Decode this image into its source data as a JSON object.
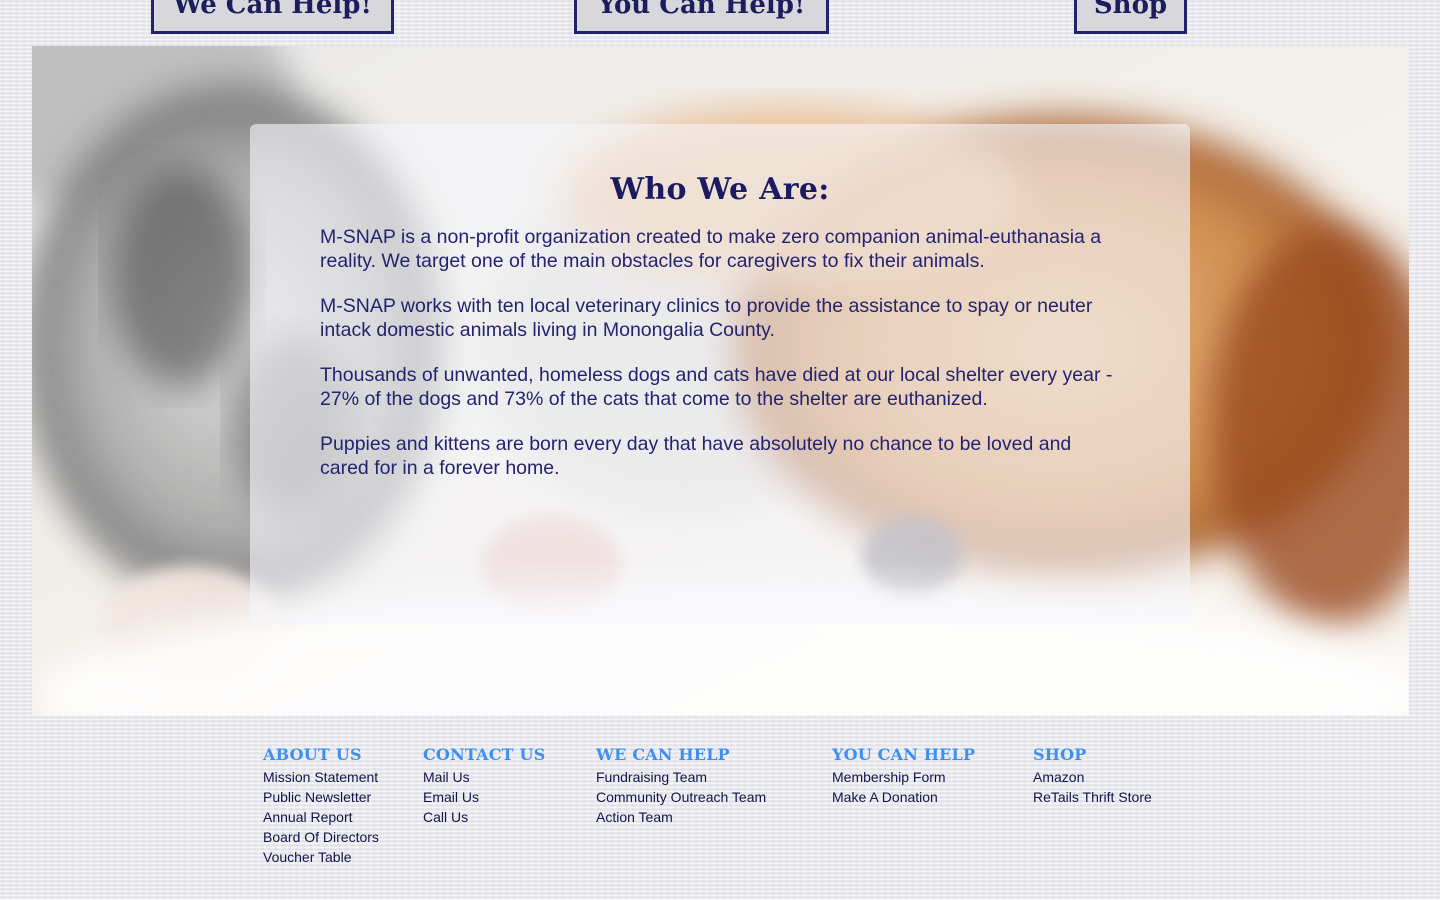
{
  "nav": {
    "tabs": [
      {
        "label": "We Can Help!"
      },
      {
        "label": "You Can Help!"
      },
      {
        "label": "Shop"
      }
    ]
  },
  "hero": {
    "title": "Who We Are:",
    "paragraphs": [
      "M-SNAP is a non-profit organization created to make zero companion animal-euthanasia a reality. We target one of the main obstacles for caregivers to fix their animals.",
      "M-SNAP works with ten local veterinary clinics to provide the assistance to spay or neuter intack domestic animals living in Monongalia County.",
      "Thousands of unwanted, homeless dogs and cats have died at our local shelter every year - 27% of the dogs and 73% of the cats that come to the shelter are euthanized.",
      "Puppies and kittens are born every day that have absolutely no chance to be loved and cared for in a forever home."
    ]
  },
  "footer": {
    "about": {
      "heading": "ABOUT US",
      "links": [
        "Mission Statement",
        "Public Newsletter",
        "Annual Report",
        "Board Of Directors",
        "Voucher Table"
      ]
    },
    "contact": {
      "heading": "CONTACT US",
      "links": [
        "Mail Us",
        "Email Us",
        "Call Us"
      ]
    },
    "we_can_help": {
      "heading": "WE CAN HELP",
      "links": [
        "Fundraising Team",
        "Community Outreach Team",
        "Action Team"
      ]
    },
    "you_can_help": {
      "heading": "YOU CAN HELP",
      "links": [
        "Membership Form",
        "Make A Donation"
      ]
    },
    "shop": {
      "heading": "SHOP",
      "links": [
        "Amazon",
        "ReTails Thrift Store"
      ]
    }
  },
  "colors": {
    "navy": "#1b1b62",
    "footer_heading_blue": "#3d8ff0",
    "tab_background": "#d8d8dc"
  }
}
